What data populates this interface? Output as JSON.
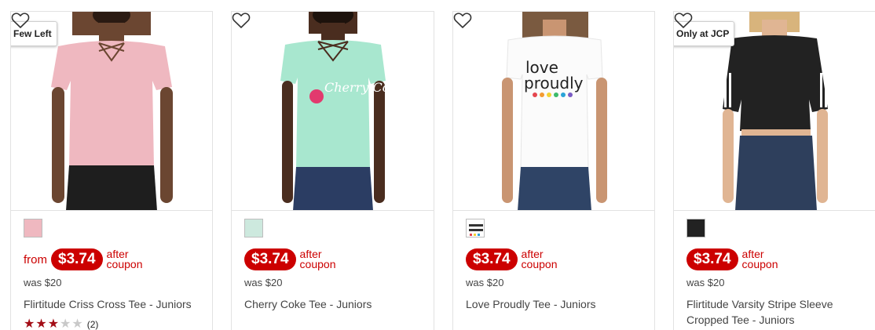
{
  "products": [
    {
      "badge": "Few Left",
      "from_label": "from",
      "price": "$3.74",
      "after_line1": "after",
      "after_line2": "coupon",
      "was": "was $20",
      "title": "Flirtitude Criss Cross Tee - Juniors",
      "rating": 3,
      "rating_max": 5,
      "review_count": "(2)",
      "shirt_color": "#efb8c0",
      "pants_color": "#1e1e1e",
      "skin": "#6b4631"
    },
    {
      "badge": "",
      "price": "$3.74",
      "after_line1": "after",
      "after_line2": "coupon",
      "was": "was $20",
      "title": "Cherry Coke Tee - Juniors",
      "graphic_text": "Cherry Coke",
      "shirt_color": "#a8e7cf",
      "pants_color": "#2b3d63",
      "skin": "#4a2d1f"
    },
    {
      "badge": "",
      "price": "$3.74",
      "after_line1": "after",
      "after_line2": "coupon",
      "was": "was $20",
      "title": "Love Proudly Tee - Juniors",
      "graphic_line1": "love",
      "graphic_line2": "proudly",
      "shirt_color": "#fbfbfb",
      "pants_color": "#2f4466",
      "skin": "#c99572"
    },
    {
      "badge": "Only at JCP",
      "price": "$3.74",
      "after_line1": "after",
      "after_line2": "coupon",
      "was": "was $20",
      "title": "Flirtitude Varsity Stripe Sleeve Cropped Tee - Juniors",
      "shirt_color": "#222222",
      "pants_color": "#2e3f5c",
      "skin": "#e0b593"
    }
  ],
  "colors": {
    "sale_red": "#cc0000",
    "star_red": "#a30d16"
  },
  "icons": {
    "favorite": "heart-outline-icon",
    "rating_on": "star-filled-icon",
    "rating_off": "star-empty-icon"
  }
}
